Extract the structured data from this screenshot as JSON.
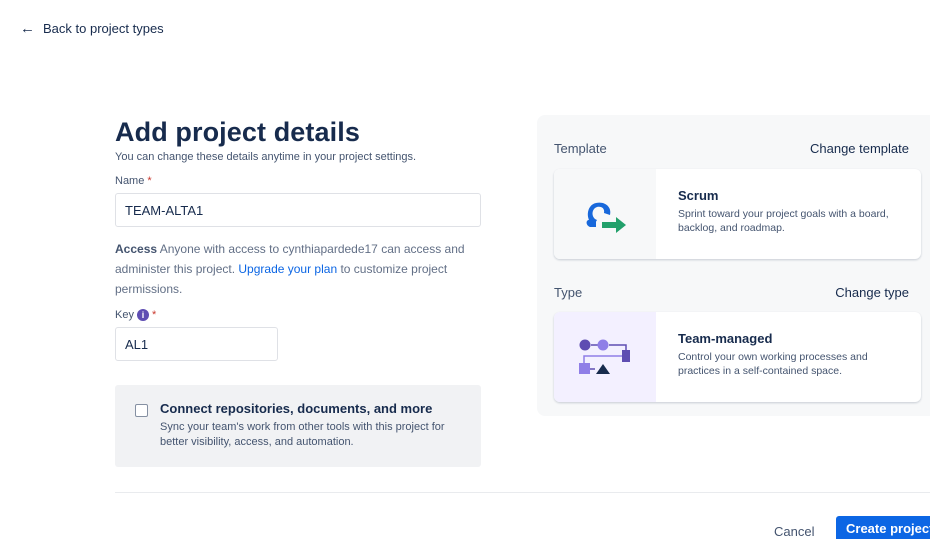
{
  "header": {
    "back_label": "Back to project types"
  },
  "form": {
    "title": "Add project details",
    "subtitle": "You can change these details anytime in your project settings.",
    "name_label": "Name",
    "required_mark": "*",
    "name_value": "TEAM-ALTA1",
    "access": {
      "label": "Access",
      "text_before_link": "Anyone with access to cynthiapardede17 can access and administer this project.",
      "link": "Upgrade your plan",
      "text_after_link": "to customize project permissions."
    },
    "key_label": "Key",
    "key_info_glyph": "i",
    "key_value": "AL1",
    "connect": {
      "title": "Connect repositories, documents, and more",
      "description": "Sync your team's work from other tools with this project for better visibility, access, and automation.",
      "checked": false
    }
  },
  "template_section": {
    "label": "Template",
    "change_label": "Change template",
    "card": {
      "icon": "scrum-icon",
      "title": "Scrum",
      "description": "Sprint toward your project goals with a board, backlog, and roadmap."
    }
  },
  "type_section": {
    "label": "Type",
    "change_label": "Change type",
    "card": {
      "icon": "team-managed-icon",
      "title": "Team-managed",
      "description": "Control your own working processes and practices in a self-contained space."
    }
  },
  "footer": {
    "cancel_label": "Cancel",
    "create_label": "Create project"
  },
  "colors": {
    "primary": "#0c66e4",
    "link": "#0c66e4",
    "required": "#c9372c",
    "scrum_blue": "#1868db",
    "scrum_green": "#22a06b",
    "team_purple": "#5e4db2"
  }
}
